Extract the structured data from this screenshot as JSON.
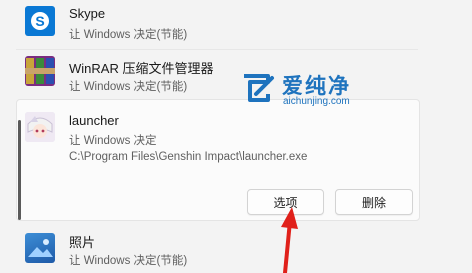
{
  "apps": [
    {
      "name": "Skype",
      "status": "让 Windows 决定(节能)",
      "icon": "skype-icon"
    },
    {
      "name": "WinRAR 压缩文件管理器",
      "status": "让 Windows 决定(节能)",
      "icon": "winrar-icon"
    },
    {
      "name": "launcher",
      "status": "让 Windows 决定",
      "path": "C:\\Program Files\\Genshin Impact\\launcher.exe",
      "icon": "launcher-icon"
    },
    {
      "name": "照片",
      "status": "让 Windows 决定(节能)",
      "icon": "photos-icon"
    }
  ],
  "card_actions": {
    "options_label": "选项",
    "delete_label": "删除"
  },
  "watermark": {
    "brand": "爱纯净",
    "url": "aichunjing.com"
  },
  "colors": {
    "accent": "#0a78d4",
    "arrow": "#e0201a"
  }
}
